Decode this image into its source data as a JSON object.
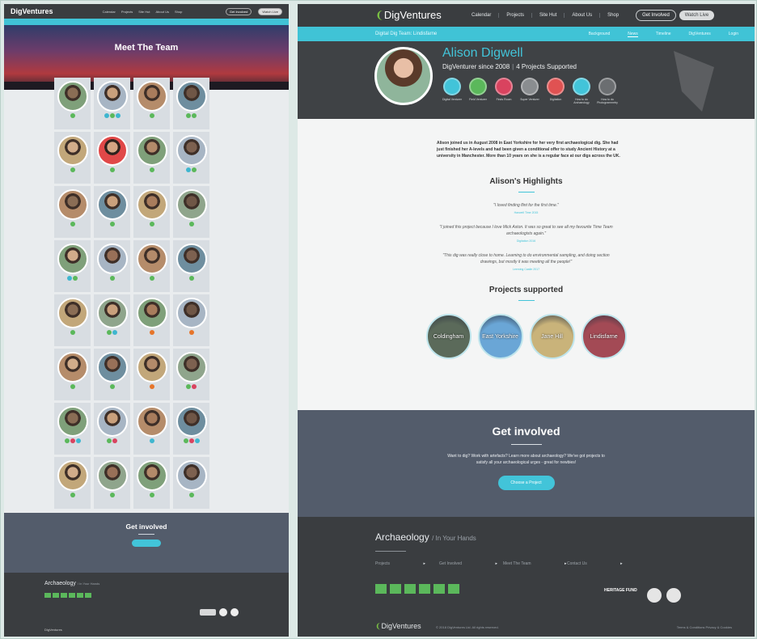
{
  "left": {
    "logo": "DigVentures",
    "nav": [
      "Calendar",
      "Projects",
      "Site Hut",
      "About Us",
      "Shop"
    ],
    "get_involved_btn": "Get Involved",
    "watch_live_btn": "Watch Live",
    "hero_title": "Meet The Team",
    "get_involved": {
      "title": "Get involved"
    },
    "footer_title": "Archaeology",
    "footer_title_sub": "/ In Your Hands",
    "footer_logo": "DigVentures"
  },
  "header": {
    "logo": "DigVentures",
    "nav": [
      "Calendar",
      "Projects",
      "Site Hut",
      "About Us",
      "Shop"
    ],
    "get_involved_btn": "Get Involved",
    "watch_live_btn": "Watch Live"
  },
  "subnav": {
    "current": "Digital Dig Team: Lindisfarne",
    "links": [
      "Background",
      "News",
      "Timeline",
      "DigVentures",
      "Login"
    ],
    "active": "News"
  },
  "profile": {
    "name": "Alison Digwell",
    "since": "DigVenturer since 2008",
    "projects_supported": "4 Projects Supported",
    "badges": [
      {
        "label": "Digital Venturer",
        "color": "#42c4d9"
      },
      {
        "label": "Field Venturer",
        "color": "#5bb85b"
      },
      {
        "label": "Finds Room",
        "color": "#d9435f"
      },
      {
        "label": "Super Venturer",
        "color": "#8a8d90"
      },
      {
        "label": "Digitation",
        "color": "#e05252"
      },
      {
        "label": "How to do Archaeology",
        "color": "#42c4d9"
      },
      {
        "label": "How to do Photogrammetry",
        "color": "#6b6e71"
      }
    ]
  },
  "bio": "Alison joined us in August 2008 in East Yorkshire for her very first archaeological dig. She had just finished her A-levels and had been given a conditional offer to study Ancient History at a university in Manchester. More than 10 years on she is a regular face at our digs across the UK.",
  "highlights": {
    "title": "Alison's Highlights",
    "quotes": [
      {
        "text": "\"I loved finding flint for the first time.\"",
        "source": "Hanwell Time 2015"
      },
      {
        "text": "\"I joined this project because I love Mick Aston. It was so great to see all my favourite Time Team archaeologists again.\"",
        "source": "Digitation 2016"
      },
      {
        "text": "\"This dig was really close to home. Learning to do environmental sampling, and doing section drawings, but mostly it was meeting all the people!\"",
        "source": "Leeming Castle 2017"
      }
    ]
  },
  "projects": {
    "title": "Projects supported",
    "items": [
      {
        "name": "Coldingham",
        "color": "#5b6a5a"
      },
      {
        "name": "East Yorkshire",
        "color": "#6aa6d6"
      },
      {
        "name": "Jane Hill",
        "color": "#c9b37a"
      },
      {
        "name": "Lindisfarne",
        "color": "#a34a55"
      }
    ]
  },
  "get_involved": {
    "title": "Get involved",
    "text": "Want to dig? Work with artefacts? Learn more about archaeology? We've got projects to satisfy all your archaeological urges - great for newbies!",
    "button": "Choose a Project"
  },
  "footer": {
    "title": "Archaeology",
    "title_sub": "/ In Your Hands",
    "links": [
      "Projects",
      "Get Involved",
      "Meet The Team",
      "Contact Us"
    ],
    "heritage": "HERITAGE FUND",
    "logo": "DigVentures",
    "copyright": "© 2018 DigVentures Ltd. All rights reserved.",
    "terms": "Terms & Conditions   Privacy & Cookies"
  }
}
